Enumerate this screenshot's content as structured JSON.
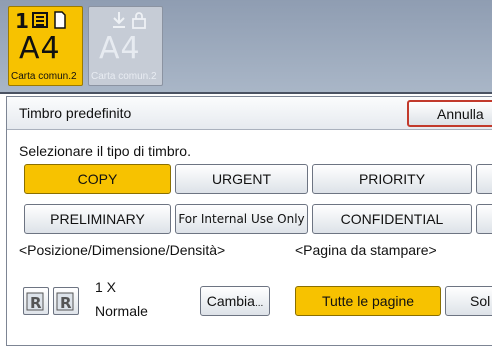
{
  "tray": {
    "selected": {
      "number": "1",
      "size": "A4",
      "paper": "Carta comun.2"
    },
    "disabled": {
      "size": "A4",
      "paper": "Carta comun.2"
    }
  },
  "dialog": {
    "title": "Timbro predefinito",
    "cancel_label": "Annulla",
    "instruction": "Selezionare il tipo di timbro."
  },
  "stamps": {
    "row1": [
      "COPY",
      "URGENT",
      "PRIORITY"
    ],
    "row2": [
      "PRELIMINARY",
      "For Internal Use Only",
      "CONFIDENTIAL"
    ],
    "selected": "COPY"
  },
  "position": {
    "heading": "<Posizione/Dimensione/Densità>",
    "scale": "1 X",
    "density": "Normale",
    "change_label": "Cambia"
  },
  "pages": {
    "heading": "<Pagina da stampare>",
    "all_label": "Tutte le pagine",
    "first_label_partial": "Sol"
  },
  "colors": {
    "selected": "#f7c200",
    "cancel_border": "#c23a2c"
  }
}
